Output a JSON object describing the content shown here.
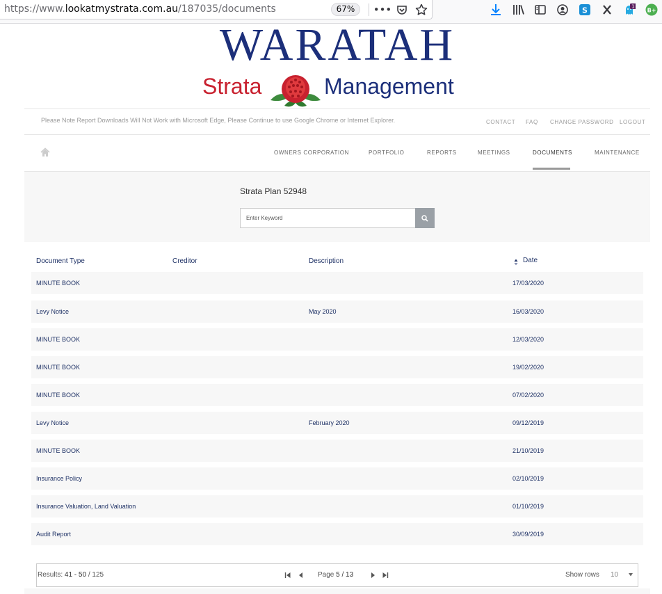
{
  "browser": {
    "url_prefix": "https://www.",
    "url_domain": "lookatmystrata.com.au",
    "url_path": "/187035/documents",
    "zoom": "67%",
    "badge_count": "1",
    "profile_initials": "B+"
  },
  "logo": {
    "top_text": "WARATAH",
    "left_text": "Strata",
    "right_text": "Management"
  },
  "notice": "Please Note Report Downloads Will Not Work with Microsoft Edge, Please Continue to use Google Chrome or Internet Explorer.",
  "top_links": [
    "CONTACT",
    "FAQ",
    "CHANGE PASSWORD",
    "LOGOUT"
  ],
  "nav": {
    "items": [
      "OWNERS CORPORATION",
      "PORTFOLIO",
      "REPORTS",
      "MEETINGS",
      "DOCUMENTS",
      "MAINTENANCE"
    ],
    "active": "DOCUMENTS"
  },
  "search": {
    "plan_title": "Strata Plan 52948",
    "placeholder": "Enter Keyword"
  },
  "table": {
    "headers": [
      "Document Type",
      "Creditor",
      "Description",
      "Date"
    ],
    "rows": [
      {
        "type": "MINUTE BOOK",
        "creditor": "",
        "description": "",
        "date": "17/03/2020"
      },
      {
        "type": "Levy Notice",
        "creditor": "",
        "description": "May 2020",
        "date": "16/03/2020"
      },
      {
        "type": "MINUTE BOOK",
        "creditor": "",
        "description": "",
        "date": "12/03/2020"
      },
      {
        "type": "MINUTE BOOK",
        "creditor": "",
        "description": "",
        "date": "19/02/2020"
      },
      {
        "type": "MINUTE BOOK",
        "creditor": "",
        "description": "",
        "date": "07/02/2020"
      },
      {
        "type": "Levy Notice",
        "creditor": "",
        "description": "February 2020",
        "date": "09/12/2019"
      },
      {
        "type": "MINUTE BOOK",
        "creditor": "",
        "description": "",
        "date": "21/10/2019"
      },
      {
        "type": "Insurance Policy",
        "creditor": "",
        "description": "",
        "date": "02/10/2019"
      },
      {
        "type": "Insurance Valuation, Land Valuation",
        "creditor": "",
        "description": "",
        "date": "01/10/2019"
      },
      {
        "type": "Audit Report",
        "creditor": "",
        "description": "",
        "date": "30/09/2019"
      }
    ]
  },
  "pagination": {
    "results_label": "Results:",
    "results_range": "41 - 50",
    "results_total": "/ 125",
    "page_label": "Page",
    "page_current": "5",
    "page_total": "/ 13",
    "show_rows_label": "Show rows",
    "rows_value": "10"
  },
  "colors": {
    "brand_navy": "#1c2f7a",
    "brand_red": "#c8212f",
    "link": "#1f3266"
  }
}
